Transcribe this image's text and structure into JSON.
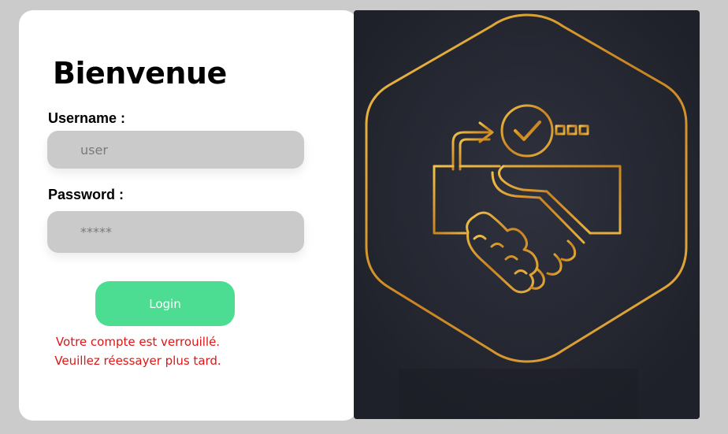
{
  "login": {
    "title": "Bienvenue",
    "username_label": "Username :",
    "username_placeholder": "user",
    "password_label": "Password :",
    "password_placeholder": "*****",
    "login_button": "Login",
    "error_line1": "Votre compte est verrouillé.",
    "error_line2": "Veuillez réessayer plus tard."
  },
  "illustration": {
    "icon": "handshake-check-icon",
    "gold": "#d79a2a",
    "background": "#23252f"
  },
  "colors": {
    "page_bg": "#cbcbcb",
    "field_bg": "#cacaca",
    "button": "#4cdc92",
    "error": "#e01414"
  }
}
